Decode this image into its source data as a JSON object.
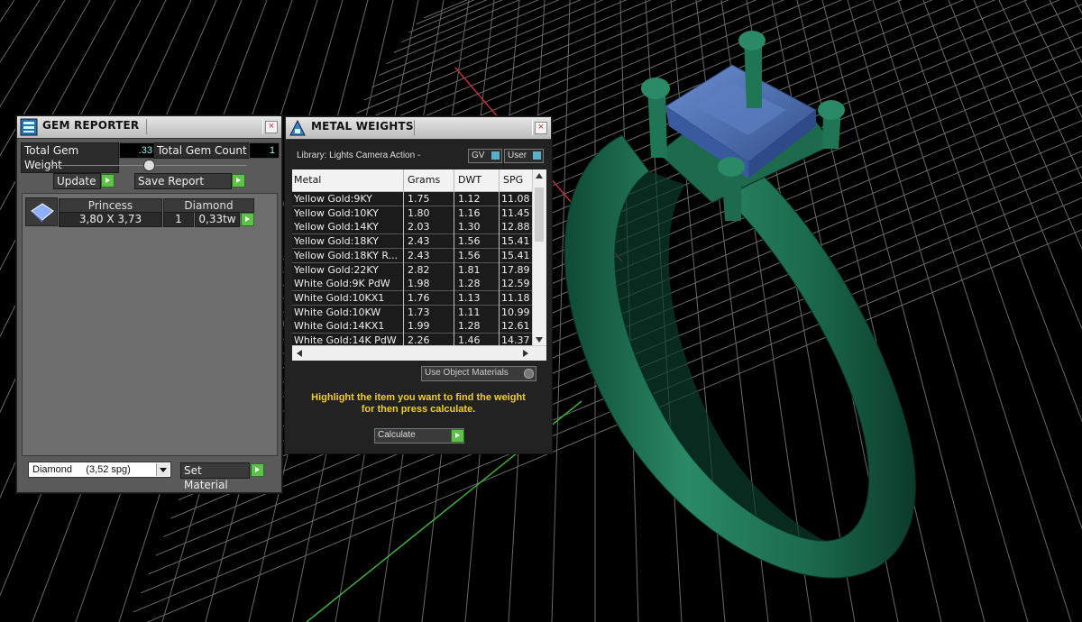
{
  "gem_reporter": {
    "title": "GEM REPORTER",
    "close": "×",
    "total_gem_weight_label": "Total Gem Weight",
    "total_gem_weight_value": ".33",
    "total_gem_count_label": "Total Gem Count",
    "total_gem_count_value": "1",
    "update_label": "Update",
    "save_report_label": "Save Report",
    "gem": {
      "cut": "Princess",
      "material": "Diamond",
      "size": "3,80 X 3,73",
      "count": "1",
      "weight": "0,33tw"
    },
    "material_select": "Diamond     (3,52 spg)",
    "set_material_label": "Set Material"
  },
  "metal_weights": {
    "title": "METAL WEIGHTS",
    "close": "×",
    "library_label": "Library: Lights Camera Action -",
    "gv_label": "GV",
    "user_label": "User",
    "columns": [
      "Metal",
      "Grams",
      "DWT",
      "SPG"
    ],
    "rows": [
      [
        "Yellow Gold:9KY",
        "1.75",
        "1.12",
        "11.08"
      ],
      [
        "Yellow Gold:10KY",
        "1.80",
        "1.16",
        "11.45"
      ],
      [
        "Yellow Gold:14KY",
        "2.03",
        "1.30",
        "12.88"
      ],
      [
        "Yellow Gold:18KY",
        "2.43",
        "1.56",
        "15.41"
      ],
      [
        "Yellow Gold:18KY R...",
        "2.43",
        "1.56",
        "15.41"
      ],
      [
        "Yellow Gold:22KY",
        "2.82",
        "1.81",
        "17.89"
      ],
      [
        "White Gold:9K PdW",
        "1.98",
        "1.28",
        "12.59"
      ],
      [
        "White Gold:10KX1",
        "1.76",
        "1.13",
        "11.18"
      ],
      [
        "White Gold:10KW",
        "1.73",
        "1.11",
        "10.99"
      ],
      [
        "White Gold:14KX1",
        "1.99",
        "1.28",
        "12.61"
      ],
      [
        "White Gold:14K PdW",
        "2.26",
        "1.46",
        "14.37"
      ]
    ],
    "use_object_materials_label": "Use Object Materials",
    "hint_line1": "Highlight the item you want to find the weight",
    "hint_line2": "for then press calculate.",
    "calculate_label": "Calculate"
  },
  "colors": {
    "ring": "#1f6b50",
    "stone": "#4a6fb0",
    "grid": "#9a9a9a",
    "axis_red": "#c0303a",
    "axis_green": "#3fae3f"
  }
}
